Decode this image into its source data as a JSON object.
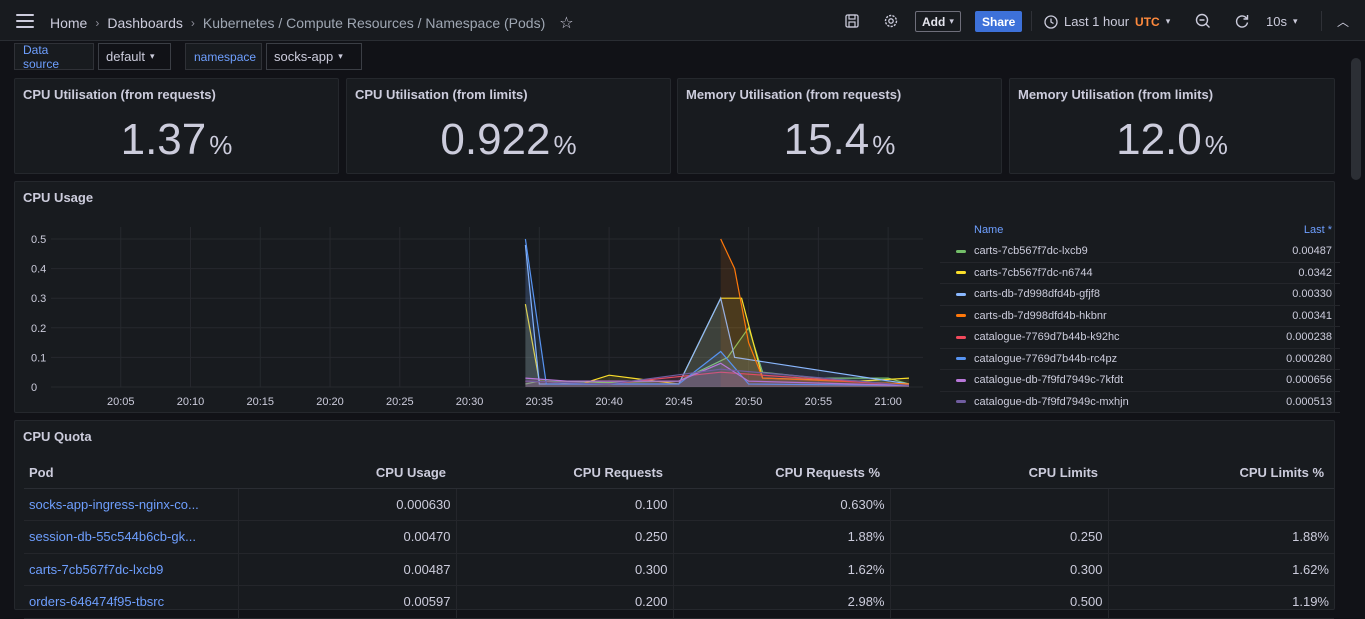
{
  "topbar": {
    "breadcrumbs": [
      "Home",
      "Dashboards",
      "Kubernetes / Compute Resources / Namespace (Pods)"
    ],
    "add_label": "Add",
    "share_label": "Share",
    "time_range": "Last 1 hour",
    "timezone": "UTC",
    "refresh_interval": "10s"
  },
  "variables": [
    {
      "label": "Data source",
      "value": "default"
    },
    {
      "label": "namespace",
      "value": "socks-app"
    }
  ],
  "stats": [
    {
      "title": "CPU Utilisation (from requests)",
      "value": "1.37",
      "unit": "%"
    },
    {
      "title": "CPU Utilisation (from limits)",
      "value": "0.922",
      "unit": "%"
    },
    {
      "title": "Memory Utilisation (from requests)",
      "value": "15.4",
      "unit": "%"
    },
    {
      "title": "Memory Utilisation (from limits)",
      "value": "12.0",
      "unit": "%"
    }
  ],
  "cpu_usage": {
    "title": "CPU Usage",
    "legend_name_header": "Name",
    "legend_last_header": "Last *",
    "legend": [
      {
        "name": "carts-7cb567f7dc-lxcb9",
        "last": "0.00487",
        "color": "#73bf69"
      },
      {
        "name": "carts-7cb567f7dc-n6744",
        "last": "0.0342",
        "color": "#fade2a"
      },
      {
        "name": "carts-db-7d998dfd4b-gfjf8",
        "last": "0.00330",
        "color": "#8ab8ff"
      },
      {
        "name": "carts-db-7d998dfd4b-hkbnr",
        "last": "0.00341",
        "color": "#ff780a"
      },
      {
        "name": "catalogue-7769d7b44b-k92hc",
        "last": "0.000238",
        "color": "#f2495c"
      },
      {
        "name": "catalogue-7769d7b44b-rc4pz",
        "last": "0.000280",
        "color": "#5794f2"
      },
      {
        "name": "catalogue-db-7f9fd7949c-7kfdt",
        "last": "0.000656",
        "color": "#b877d9"
      },
      {
        "name": "catalogue-db-7f9fd7949c-mxhjn",
        "last": "0.000513",
        "color": "#705da0"
      }
    ]
  },
  "chart_data": {
    "type": "line",
    "title": "CPU Usage",
    "x": [
      "20:05",
      "20:10",
      "20:15",
      "20:20",
      "20:25",
      "20:30",
      "20:35",
      "20:40",
      "20:45",
      "20:50",
      "20:55",
      "21:00"
    ],
    "ylim": [
      0,
      0.5
    ],
    "yticks": [
      "0",
      "0.1",
      "0.2",
      "0.3",
      "0.4",
      "0.5"
    ],
    "grid": true,
    "series": [
      {
        "name": "carts-7cb567f7dc-lxcb9",
        "color": "#73bf69",
        "points": [
          [
            34.0,
            0.01
          ],
          [
            35.0,
            0.02
          ],
          [
            40.0,
            0.015
          ],
          [
            45.0,
            0.02
          ],
          [
            48.5,
            0.1
          ],
          [
            50.0,
            0.2
          ],
          [
            51.0,
            0.05
          ],
          [
            55.0,
            0.03
          ],
          [
            60.0,
            0.03
          ],
          [
            61.5,
            0.01
          ]
        ]
      },
      {
        "name": "carts-7cb567f7dc-n6744",
        "color": "#fade2a",
        "points": [
          [
            34.0,
            0.28
          ],
          [
            35.0,
            0.02
          ],
          [
            38.0,
            0.01
          ],
          [
            40.0,
            0.04
          ],
          [
            45.0,
            0.01
          ],
          [
            48.0,
            0.3
          ],
          [
            49.5,
            0.3
          ],
          [
            51.0,
            0.03
          ],
          [
            58.0,
            0.02
          ],
          [
            61.5,
            0.03
          ]
        ]
      },
      {
        "name": "carts-db-7d998dfd4b-gfjf8",
        "color": "#8ab8ff",
        "points": [
          [
            34.0,
            0.48
          ],
          [
            35.0,
            0.01
          ],
          [
            45.0,
            0.01
          ],
          [
            48.0,
            0.3
          ],
          [
            49.0,
            0.1
          ],
          [
            61.5,
            0.01
          ]
        ]
      },
      {
        "name": "carts-db-7d998dfd4b-hkbnr",
        "color": "#ff780a",
        "points": [
          [
            48.0,
            0.5
          ],
          [
            49.0,
            0.4
          ],
          [
            50.0,
            0.15
          ],
          [
            51.0,
            0.03
          ],
          [
            61.5,
            0.01
          ]
        ]
      },
      {
        "name": "catalogue-7769d7b44b-k92hc",
        "color": "#f2495c",
        "points": [
          [
            34.0,
            0.02
          ],
          [
            40.0,
            0.01
          ],
          [
            48.0,
            0.05
          ],
          [
            61.5,
            0.005
          ]
        ]
      },
      {
        "name": "catalogue-7769d7b44b-rc4pz",
        "color": "#5794f2",
        "points": [
          [
            34.0,
            0.5
          ],
          [
            35.5,
            0.01
          ],
          [
            45.0,
            0.01
          ],
          [
            48.0,
            0.12
          ],
          [
            50.0,
            0.01
          ],
          [
            61.5,
            0.005
          ]
        ]
      },
      {
        "name": "catalogue-db-7f9fd7949c-7kfdt",
        "color": "#b877d9",
        "points": [
          [
            34.0,
            0.03
          ],
          [
            37.0,
            0.02
          ],
          [
            45.0,
            0.02
          ],
          [
            48.0,
            0.08
          ],
          [
            50.0,
            0.02
          ],
          [
            61.5,
            0.005
          ]
        ]
      },
      {
        "name": "catalogue-db-7f9fd7949c-mxhjn",
        "color": "#705da0",
        "points": [
          [
            34.0,
            0.02
          ],
          [
            40.0,
            0.01
          ],
          [
            48.0,
            0.06
          ],
          [
            61.5,
            0.005
          ]
        ]
      }
    ]
  },
  "cpu_quota": {
    "title": "CPU Quota",
    "columns": [
      "Pod",
      "CPU Usage",
      "CPU Requests",
      "CPU Requests %",
      "CPU Limits",
      "CPU Limits %"
    ],
    "rows": [
      [
        "socks-app-ingress-nginx-co...",
        "0.000630",
        "0.100",
        "0.630%",
        "",
        ""
      ],
      [
        "session-db-55c544b6cb-gk...",
        "0.00470",
        "0.250",
        "1.88%",
        "0.250",
        "1.88%"
      ],
      [
        "carts-7cb567f7dc-lxcb9",
        "0.00487",
        "0.300",
        "1.62%",
        "0.300",
        "1.62%"
      ],
      [
        "orders-646474f95-tbsrc",
        "0.00597",
        "0.200",
        "2.98%",
        "0.500",
        "1.19%"
      ]
    ]
  }
}
